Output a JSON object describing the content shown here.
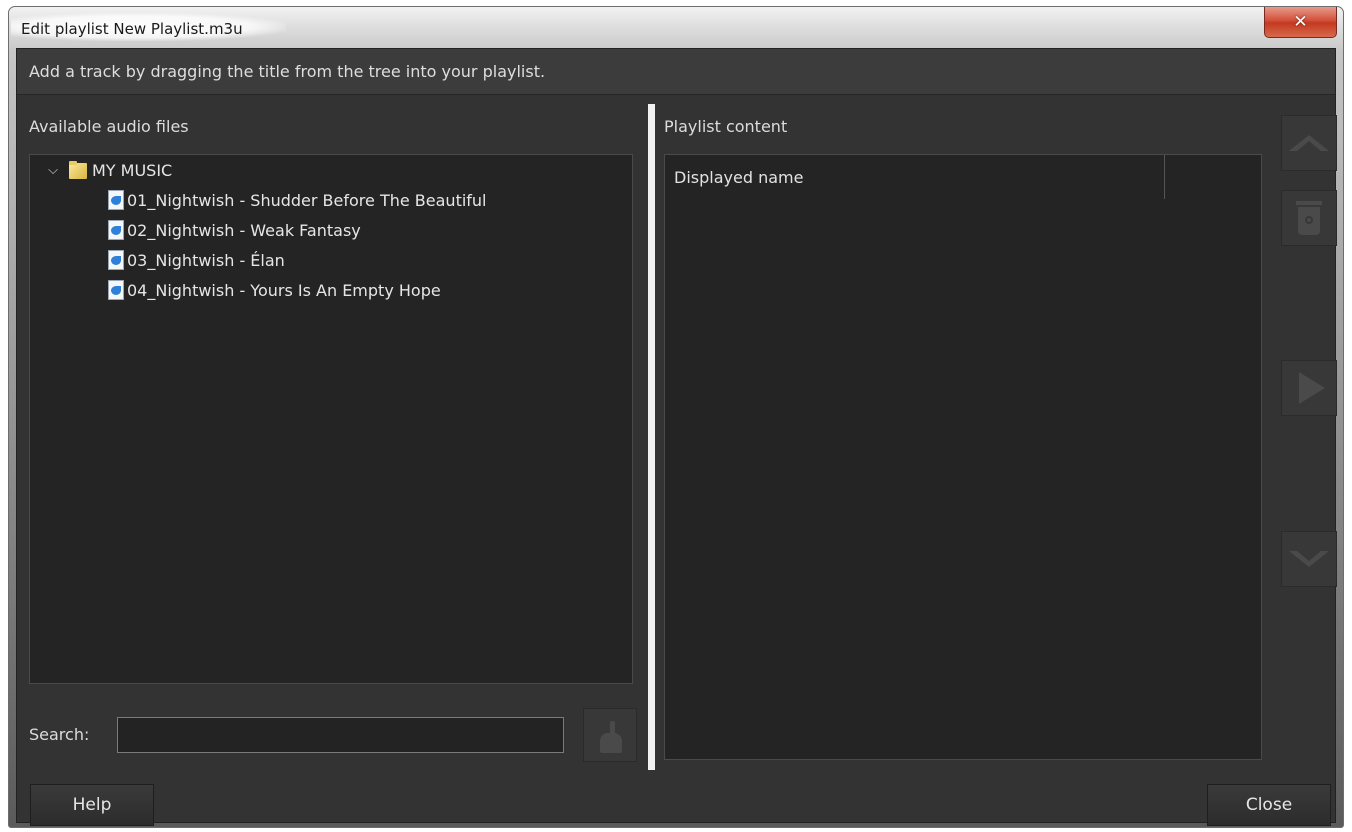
{
  "window": {
    "title": "Edit playlist New Playlist.m3u",
    "close_glyph": "✕"
  },
  "hint_text": "Add a track by dragging the title from the tree into your playlist.",
  "left_panel": {
    "label": "Available audio files",
    "tree": {
      "root": {
        "label": "MY MUSIC",
        "expanded": true,
        "icon": "folder-icon"
      },
      "items": [
        {
          "label": "01_Nightwish - Shudder Before The Beautiful",
          "icon": "audio-file-icon"
        },
        {
          "label": "02_Nightwish - Weak Fantasy",
          "icon": "audio-file-icon"
        },
        {
          "label": "03_Nightwish - Élan",
          "icon": "audio-file-icon"
        },
        {
          "label": "04_Nightwish - Yours Is An Empty Hope",
          "icon": "audio-file-icon"
        }
      ]
    },
    "search_label": "Search:",
    "search_value": "",
    "clear_icon": "broom-icon"
  },
  "right_panel": {
    "label": "Playlist content",
    "columns": [
      "Displayed name"
    ],
    "side_buttons": [
      "move-up-icon",
      "delete-icon",
      "play-icon",
      "move-down-icon"
    ]
  },
  "footer": {
    "help_label": "Help",
    "close_label": "Close"
  }
}
